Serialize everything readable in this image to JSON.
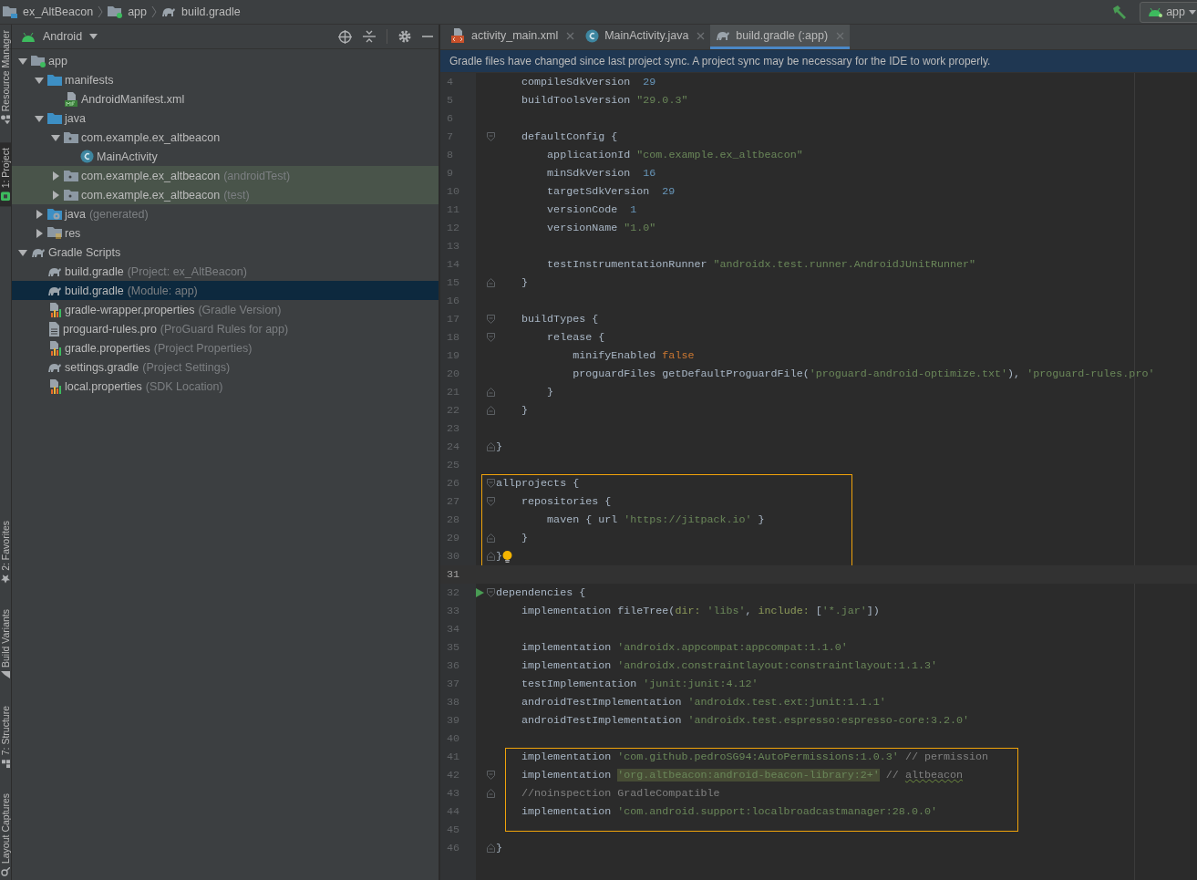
{
  "breadcrumbs": [
    {
      "label": "ex_AltBeacon",
      "kind": "project"
    },
    {
      "label": "app",
      "kind": "module"
    },
    {
      "label": "build.gradle",
      "kind": "gradle"
    }
  ],
  "run_config": {
    "label": "app"
  },
  "tool_strip_top": [
    {
      "label": "Resource Manager",
      "kind": "resource",
      "selected": false
    },
    {
      "label": "1: Project",
      "kind": "project",
      "selected": true
    }
  ],
  "tool_strip_bottom": [
    {
      "label": "2: Favorites",
      "kind": "star",
      "selected": false
    },
    {
      "label": "Build Variants",
      "kind": "variants",
      "selected": false
    },
    {
      "label": "7: Structure",
      "kind": "structure",
      "selected": false
    },
    {
      "label": "Layout Captures",
      "kind": "captures",
      "selected": false
    }
  ],
  "project_panel": {
    "view": "Android",
    "tree": [
      {
        "label": "app",
        "kind": "module",
        "expanded": true,
        "selected": false,
        "highlighted": false,
        "children": [
          {
            "label": "manifests",
            "kind": "folder",
            "expanded": true,
            "selected": false,
            "highlighted": false,
            "children": [
              {
                "label": "AndroidManifest.xml",
                "kind": "manifest",
                "selected": false,
                "highlighted": false
              }
            ]
          },
          {
            "label": "java",
            "kind": "folder",
            "expanded": true,
            "selected": false,
            "highlighted": false,
            "children": [
              {
                "label": "com.example.ex_altbeacon",
                "kind": "package",
                "expanded": true,
                "selected": false,
                "highlighted": false,
                "children": [
                  {
                    "label": "MainActivity",
                    "kind": "class",
                    "selected": false,
                    "highlighted": false
                  }
                ]
              },
              {
                "label": "com.example.ex_altbeacon",
                "hint": "(androidTest)",
                "kind": "package",
                "expanded": false,
                "selected": false,
                "highlighted": true
              },
              {
                "label": "com.example.ex_altbeacon",
                "hint": "(test)",
                "kind": "package",
                "expanded": false,
                "selected": false,
                "highlighted": true
              }
            ]
          },
          {
            "label": "java",
            "hint": "(generated)",
            "kind": "generated",
            "expanded": false,
            "selected": false,
            "highlighted": false
          },
          {
            "label": "res",
            "kind": "res",
            "expanded": false,
            "selected": false,
            "highlighted": false
          }
        ]
      },
      {
        "label": "Gradle Scripts",
        "kind": "gradle",
        "expanded": true,
        "selected": false,
        "highlighted": false,
        "children": [
          {
            "label": "build.gradle",
            "hint": "(Project: ex_AltBeacon)",
            "kind": "gradle",
            "selected": false,
            "highlighted": false
          },
          {
            "label": "build.gradle",
            "hint": "(Module: app)",
            "kind": "gradle",
            "selected": true,
            "highlighted": false
          },
          {
            "label": "gradle-wrapper.properties",
            "hint": "(Gradle Version)",
            "kind": "properties",
            "selected": false,
            "highlighted": false
          },
          {
            "label": "proguard-rules.pro",
            "hint": "(ProGuard Rules for app)",
            "kind": "text",
            "selected": false,
            "highlighted": false
          },
          {
            "label": "gradle.properties",
            "hint": "(Project Properties)",
            "kind": "properties",
            "selected": false,
            "highlighted": false
          },
          {
            "label": "settings.gradle",
            "hint": "(Project Settings)",
            "kind": "gradle",
            "selected": false,
            "highlighted": false
          },
          {
            "label": "local.properties",
            "hint": "(SDK Location)",
            "kind": "properties",
            "selected": false,
            "highlighted": false
          }
        ]
      }
    ]
  },
  "editor": {
    "tabs": [
      {
        "label": "activity_main.xml",
        "kind": "xml",
        "selected": false
      },
      {
        "label": "MainActivity.java",
        "kind": "class",
        "selected": false
      },
      {
        "label": "build.gradle (:app)",
        "kind": "gradle",
        "selected": true
      }
    ],
    "notification": "Gradle files have changed since last project sync. A project sync may be necessary for the IDE to work properly.",
    "blocks": [
      {
        "boxed": false,
        "lines": [
          {
            "number": "4",
            "kind": "plain",
            "current": false,
            "tokens": [
              {
                "kind": "plain",
                "text": "    compileSdkVersion "
              },
              {
                "kind": "num",
                "text": "29"
              }
            ]
          },
          {
            "number": "5",
            "kind": "plain",
            "current": false,
            "tokens": [
              {
                "kind": "plain",
                "text": "    buildToolsVersion "
              },
              {
                "kind": "str",
                "text": "\"29.0.3\""
              }
            ]
          },
          {
            "number": "6",
            "kind": "plain",
            "current": false
          },
          {
            "number": "7",
            "kind": "opener",
            "current": false,
            "tokens": [
              {
                "kind": "plain",
                "text": "    defaultConfig {"
              }
            ]
          },
          {
            "number": "8",
            "kind": "plain",
            "current": false,
            "tokens": [
              {
                "kind": "plain",
                "text": "        applicationId "
              },
              {
                "kind": "str",
                "text": "\"com.example.ex_altbeacon\""
              }
            ]
          },
          {
            "number": "9",
            "kind": "plain",
            "current": false,
            "tokens": [
              {
                "kind": "plain",
                "text": "        minSdkVersion "
              },
              {
                "kind": "num",
                "text": "16"
              }
            ]
          },
          {
            "number": "10",
            "kind": "plain",
            "current": false,
            "tokens": [
              {
                "kind": "plain",
                "text": "        targetSdkVersion "
              },
              {
                "kind": "num",
                "text": "29"
              }
            ]
          },
          {
            "number": "11",
            "kind": "plain",
            "current": false,
            "tokens": [
              {
                "kind": "plain",
                "text": "        versionCode "
              },
              {
                "kind": "num",
                "text": "1"
              }
            ]
          },
          {
            "number": "12",
            "kind": "plain",
            "current": false,
            "tokens": [
              {
                "kind": "plain",
                "text": "        versionName "
              },
              {
                "kind": "str",
                "text": "\"1.0\""
              }
            ]
          },
          {
            "number": "13",
            "kind": "plain",
            "current": false
          },
          {
            "number": "14",
            "kind": "plain",
            "current": false,
            "tokens": [
              {
                "kind": "plain",
                "text": "        testInstrumentationRunner "
              },
              {
                "kind": "str",
                "text": "\"androidx.test.runner.AndroidJUnitRunner\""
              }
            ]
          },
          {
            "number": "15",
            "kind": "closer",
            "current": false,
            "tokens": [
              {
                "kind": "plain",
                "text": "    }"
              }
            ]
          },
          {
            "number": "16",
            "kind": "plain",
            "current": false
          },
          {
            "number": "17",
            "kind": "opener",
            "current": false,
            "tokens": [
              {
                "kind": "plain",
                "text": "    buildTypes {"
              }
            ]
          },
          {
            "number": "18",
            "kind": "opener",
            "current": false,
            "tokens": [
              {
                "kind": "plain",
                "text": "        release {"
              }
            ]
          },
          {
            "number": "19",
            "kind": "plain",
            "current": false,
            "tokens": [
              {
                "kind": "plain",
                "text": "            minifyEnabled "
              },
              {
                "kind": "kw",
                "text": "false"
              }
            ]
          },
          {
            "number": "20",
            "kind": "plain",
            "current": false,
            "tokens": [
              {
                "kind": "plain",
                "text": "            proguardFiles getDefaultProguardFile("
              },
              {
                "kind": "str",
                "text": "'proguard-android-optimize.txt'"
              },
              {
                "kind": "plain",
                "text": "), "
              },
              {
                "kind": "str",
                "text": "'proguard-rules.pro'"
              }
            ]
          },
          {
            "number": "21",
            "kind": "closer",
            "current": false,
            "tokens": [
              {
                "kind": "plain",
                "text": "        }"
              }
            ]
          },
          {
            "number": "22",
            "kind": "closer",
            "current": false,
            "tokens": [
              {
                "kind": "plain",
                "text": "    }"
              }
            ]
          },
          {
            "number": "23",
            "kind": "plain",
            "current": false
          },
          {
            "number": "24",
            "kind": "closer",
            "current": false,
            "tokens": [
              {
                "kind": "plain",
                "text": "}"
              }
            ]
          },
          {
            "number": "25",
            "kind": "plain",
            "current": false
          }
        ]
      },
      {
        "boxed": true,
        "lines": [
          {
            "number": "26",
            "kind": "opener",
            "current": false,
            "tokens": [
              {
                "kind": "plain",
                "text": "allprojects {"
              }
            ]
          },
          {
            "number": "27",
            "kind": "opener",
            "current": false,
            "tokens": [
              {
                "kind": "plain",
                "text": "    repositories {"
              }
            ]
          },
          {
            "number": "28",
            "kind": "plain",
            "current": false,
            "tokens": [
              {
                "kind": "plain",
                "text": "        maven { url "
              },
              {
                "kind": "str",
                "text": "'https://jitpack.io'"
              },
              {
                "kind": "plain",
                "text": " }"
              }
            ]
          },
          {
            "number": "29",
            "kind": "closer",
            "current": false,
            "tokens": [
              {
                "kind": "plain",
                "text": "    }"
              }
            ]
          },
          {
            "number": "30",
            "kind": "closer",
            "current": false,
            "bulb": true,
            "tokens": [
              {
                "kind": "plain",
                "text": "}"
              }
            ]
          }
        ]
      },
      {
        "boxed": false,
        "lines": [
          {
            "number": "31",
            "kind": "plain",
            "current": true
          },
          {
            "number": "32",
            "kind": "opener",
            "current": false,
            "run": true,
            "tokens": [
              {
                "kind": "plain",
                "text": "dependencies {"
              }
            ]
          },
          {
            "number": "33",
            "kind": "plain",
            "current": false,
            "tokens": [
              {
                "kind": "plain",
                "text": "    implementation fileTree("
              },
              {
                "kind": "named",
                "text": "dir:"
              },
              {
                "kind": "str",
                "text": " 'libs'"
              },
              {
                "kind": "plain",
                "text": ", "
              },
              {
                "kind": "named",
                "text": "include:"
              },
              {
                "kind": "plain",
                "text": " ["
              },
              {
                "kind": "str",
                "text": "'*.jar'"
              },
              {
                "kind": "plain",
                "text": "])"
              }
            ]
          },
          {
            "number": "34",
            "kind": "plain",
            "current": false
          },
          {
            "number": "35",
            "kind": "plain",
            "current": false,
            "tokens": [
              {
                "kind": "plain",
                "text": "    implementation "
              },
              {
                "kind": "str",
                "text": "'androidx.appcompat:appcompat:1.1.0'"
              }
            ]
          },
          {
            "number": "36",
            "kind": "plain",
            "current": false,
            "tokens": [
              {
                "kind": "plain",
                "text": "    implementation "
              },
              {
                "kind": "str",
                "text": "'androidx.constraintlayout:constraintlayout:1.1.3'"
              }
            ]
          },
          {
            "number": "37",
            "kind": "plain",
            "current": false,
            "tokens": [
              {
                "kind": "plain",
                "text": "    testImplementation "
              },
              {
                "kind": "str",
                "text": "'junit:junit:4.12'"
              }
            ]
          },
          {
            "number": "38",
            "kind": "plain",
            "current": false,
            "tokens": [
              {
                "kind": "plain",
                "text": "    androidTestImplementation "
              },
              {
                "kind": "str",
                "text": "'androidx.test.ext:junit:1.1.1'"
              }
            ]
          },
          {
            "number": "39",
            "kind": "plain",
            "current": false,
            "tokens": [
              {
                "kind": "plain",
                "text": "    androidTestImplementation "
              },
              {
                "kind": "str",
                "text": "'androidx.test.espresso:espresso-core:3.2.0'"
              }
            ]
          },
          {
            "number": "40",
            "kind": "plain",
            "current": false
          }
        ]
      },
      {
        "boxed": true,
        "lines": [
          {
            "number": "41",
            "kind": "plain",
            "current": false,
            "tokens": [
              {
                "kind": "plain",
                "text": "    implementation "
              },
              {
                "kind": "str",
                "text": "'com.github.pedroSG94:AutoPermissions:1.0.3'"
              },
              {
                "kind": "comment",
                "text": " // permission"
              }
            ]
          },
          {
            "number": "42",
            "kind": "opener",
            "current": false,
            "tokens": [
              {
                "kind": "plain",
                "text": "    implementation "
              },
              {
                "kind": "highlight",
                "text": "'org.altbeacon:android-beacon-library:2+'"
              },
              {
                "kind": "comment",
                "text": " // "
              },
              {
                "kind": "typo",
                "text": "altbeacon"
              }
            ]
          },
          {
            "number": "43",
            "kind": "closer",
            "current": false,
            "tokens": [
              {
                "kind": "comment",
                "text": "    //noinspection GradleCompatible"
              }
            ]
          },
          {
            "number": "44",
            "kind": "plain",
            "current": false,
            "tokens": [
              {
                "kind": "plain",
                "text": "    implementation "
              },
              {
                "kind": "str",
                "text": "'com.android.support:localbroadcastmanager:28.0.0'"
              }
            ]
          }
        ]
      },
      {
        "boxed": false,
        "lines": [
          {
            "number": "45",
            "kind": "plain",
            "current": false
          },
          {
            "number": "46",
            "kind": "closer",
            "current": false,
            "tokens": [
              {
                "kind": "plain",
                "text": "}"
              }
            ]
          }
        ]
      }
    ]
  }
}
